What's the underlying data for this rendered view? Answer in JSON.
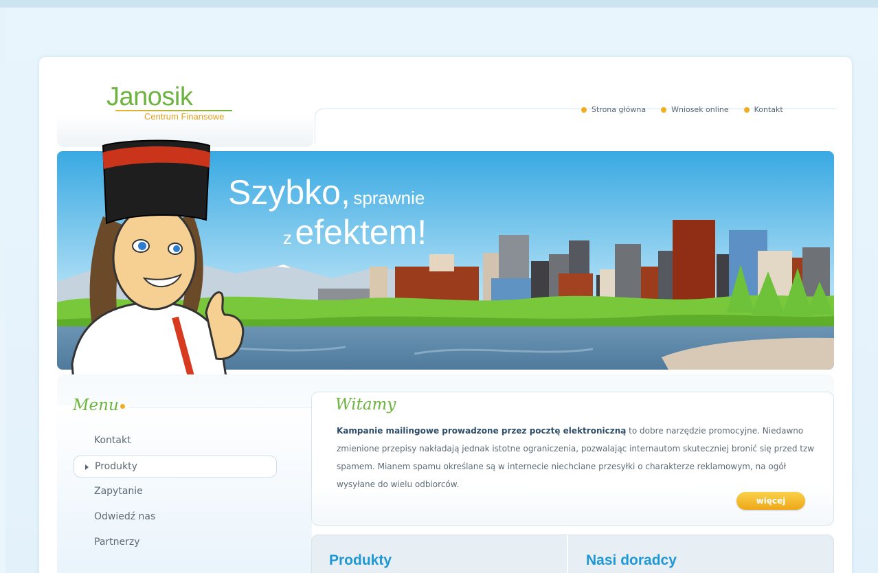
{
  "logo": {
    "title": "Janosik",
    "subtitle": "Centrum Finansowe"
  },
  "topnav": [
    {
      "label": "Strona główna"
    },
    {
      "label": "Wniosek online"
    },
    {
      "label": "Kontakt"
    }
  ],
  "banner": {
    "slogan_big1": "Szybko,",
    "slogan_small1": "sprawnie",
    "slogan_small2": "z",
    "slogan_big2": "efektem!"
  },
  "menu": {
    "title": "Menu",
    "items": [
      {
        "label": "Kontakt"
      },
      {
        "label": "Produkty"
      },
      {
        "label": "Zapytanie"
      },
      {
        "label": "Odwiedź nas"
      },
      {
        "label": "Partnerzy"
      }
    ]
  },
  "welcome": {
    "title": "Witamy",
    "bold_lead": "Kampanie mailingowe prowadzone przez pocztę elektroniczną",
    "text_rest": " to dobre narzędzie promocyjne. Niedawno zmienione przepisy nakładają jednak istotne ograniczenia, pozwalając internautom skuteczniej bronić się przed tzw spamem. Mianem spamu określane są w internecie niechciane przesyłki o charakterze reklamowym, na ogół wysyłane do wielu odbiorców.",
    "more_label": "więcej"
  },
  "bottom": {
    "left_title": "Produkty",
    "right_title": "Nasi doradcy"
  },
  "colors": {
    "green": "#6db33f",
    "orange": "#f1ad1c",
    "blue": "#1f98d6"
  }
}
